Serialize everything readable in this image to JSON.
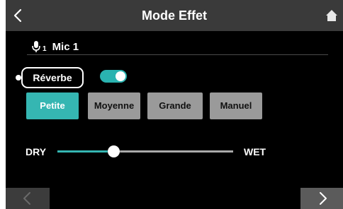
{
  "header": {
    "title": "Mode Effet",
    "back_icon": "chevron-left-icon",
    "home_icon": "home-icon"
  },
  "mic": {
    "icon": "microphone-icon",
    "subscript": "1",
    "label": "Mic 1"
  },
  "reverb": {
    "label": "Réverbe",
    "enabled": true
  },
  "size_buttons": [
    {
      "label": "Petite",
      "selected": true
    },
    {
      "label": "Moyenne",
      "selected": false
    },
    {
      "label": "Grande",
      "selected": false
    },
    {
      "label": "Manuel",
      "selected": false
    }
  ],
  "mix": {
    "dry_label": "DRY",
    "wet_label": "WET",
    "level_fraction": 0.32
  },
  "footer": {
    "prev_icon": "chevron-left-icon",
    "next_icon": "chevron-right-icon"
  },
  "colors": {
    "accent": "#35b6b2",
    "screen_bg": "#000000",
    "header_bg": "#3a3a3a",
    "button_gray": "#9a9a9a"
  }
}
